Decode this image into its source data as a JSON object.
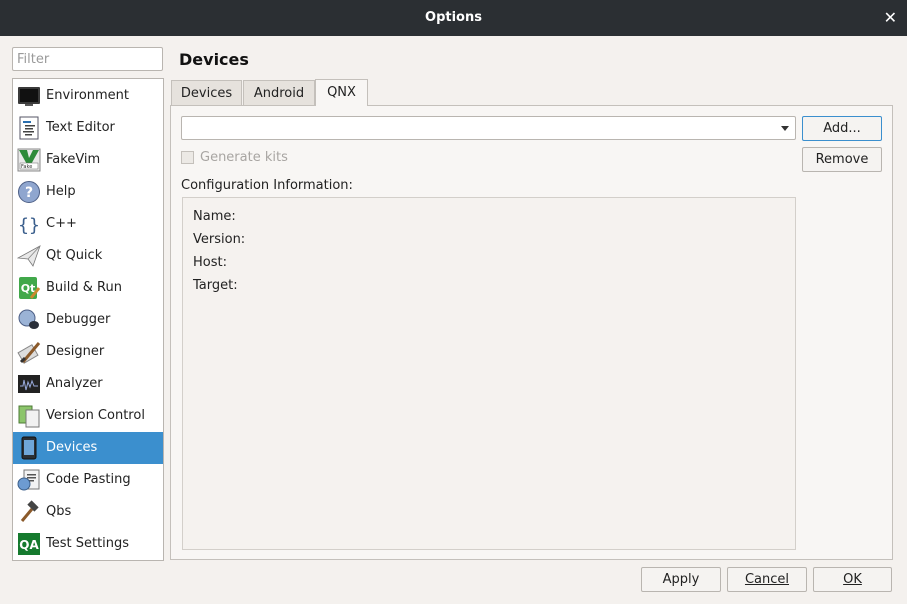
{
  "window": {
    "title": "Options"
  },
  "filter": {
    "placeholder": "Filter",
    "value": ""
  },
  "sidebar": {
    "items": [
      {
        "label": "Environment",
        "icon": "monitor-icon"
      },
      {
        "label": "Text Editor",
        "icon": "text-document-icon"
      },
      {
        "label": "FakeVim",
        "icon": "fakevim-icon"
      },
      {
        "label": "Help",
        "icon": "help-icon"
      },
      {
        "label": "C++",
        "icon": "braces-icon"
      },
      {
        "label": "Qt Quick",
        "icon": "paper-plane-icon"
      },
      {
        "label": "Build & Run",
        "icon": "qt-build-icon"
      },
      {
        "label": "Debugger",
        "icon": "bug-icon"
      },
      {
        "label": "Designer",
        "icon": "brush-icon"
      },
      {
        "label": "Analyzer",
        "icon": "oscilloscope-icon"
      },
      {
        "label": "Version Control",
        "icon": "documents-icon"
      },
      {
        "label": "Devices",
        "icon": "device-icon",
        "selected": true
      },
      {
        "label": "Code Pasting",
        "icon": "clipboard-globe-icon"
      },
      {
        "label": "Qbs",
        "icon": "hammer-icon"
      },
      {
        "label": "Test Settings",
        "icon": "qa-icon"
      }
    ]
  },
  "page": {
    "title": "Devices"
  },
  "tabs": [
    {
      "label": "Devices"
    },
    {
      "label": "Android"
    },
    {
      "label": "QNX",
      "active": true
    }
  ],
  "qnx": {
    "add_label": "Add...",
    "remove_label": "Remove",
    "generate_kits_label": "Generate kits",
    "config_info_label": "Configuration Information:",
    "fields": {
      "name": "Name:",
      "version": "Version:",
      "host": "Host:",
      "target": "Target:"
    }
  },
  "footer": {
    "apply_label": "Apply",
    "cancel_label": "Cancel",
    "ok_label": "OK"
  },
  "colors": {
    "selection": "#3b8fce",
    "titlebar": "#2b2f33"
  }
}
